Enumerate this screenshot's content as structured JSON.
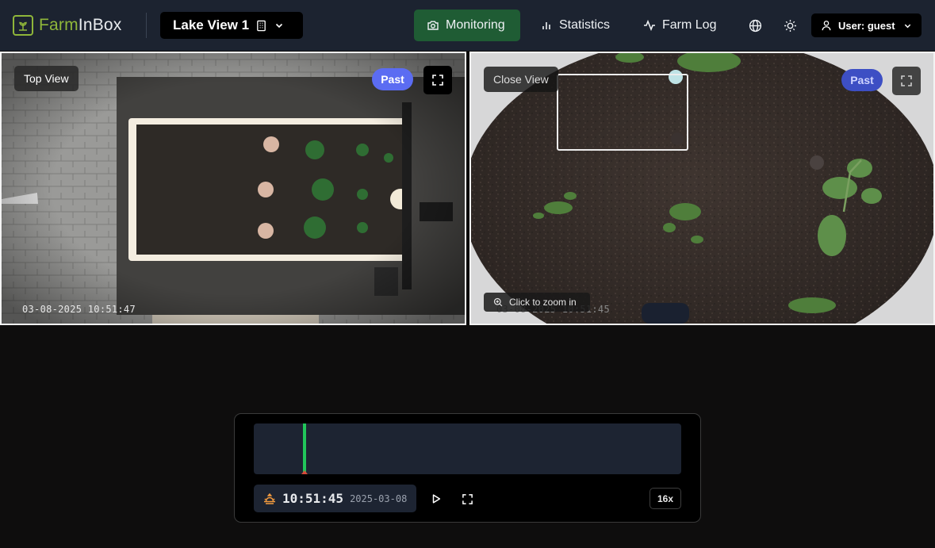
{
  "app": {
    "logo_parts": [
      "Farm",
      "In",
      "Box"
    ],
    "brand_color": "#8fb63a",
    "farm_name": "Lake View 1",
    "farm_icon": "building-icon"
  },
  "nav": {
    "monitoring": "Monitoring",
    "statistics": "Statistics",
    "farm_log": "Farm Log",
    "active": "monitoring",
    "active_color": "#1f5c34"
  },
  "user": {
    "label": "User: guest"
  },
  "cameras": {
    "top": {
      "label": "Top View",
      "badge": "Past",
      "timestamp": "03-08-2025 10:51:47"
    },
    "close": {
      "label": "Close View",
      "badge": "Past",
      "timestamp": "03-08-2025 10:51:45",
      "zoom_hint": "Click to zoom in"
    }
  },
  "player": {
    "time": "10:51:45",
    "date": "2025-03-08",
    "speed": "16x",
    "playhead_position": 0.115,
    "playhead_color": "#21c65a"
  }
}
